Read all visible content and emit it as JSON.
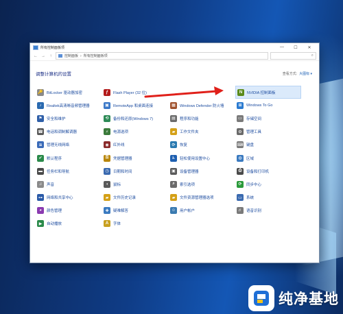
{
  "window": {
    "title": "所有控制面板项",
    "controls": {
      "minimize": "—",
      "maximize": "☐",
      "close": "✕"
    }
  },
  "address": {
    "back": "←",
    "forward": "→",
    "up": "↑",
    "breadcrumbs": [
      "控制面板",
      "所有控制面板项"
    ],
    "search_icon": "⌕"
  },
  "header": {
    "title": "调整计算机的设置",
    "view_by_label": "查看方式:",
    "view_by_value": "大图标 ▾"
  },
  "items": [
    {
      "label": "BitLocker 驱动器加密",
      "icon": "bitlocker-icon",
      "color": "#8a8a8a",
      "glyph": "🔑"
    },
    {
      "label": "Flash Player (32 位)",
      "icon": "flash-icon",
      "color": "#b31b1b",
      "glyph": "ƒ"
    },
    {
      "label": "",
      "icon": "blank-icon",
      "color": "#ffffff",
      "glyph": ""
    },
    {
      "label": "NVIDIA 控制面板",
      "icon": "nvidia-icon",
      "color": "#5a8a1a",
      "glyph": "N"
    },
    {
      "label": "Realtek高清晰音频管理器",
      "icon": "realtek-audio-icon",
      "color": "#2a6ab0",
      "glyph": "♪"
    },
    {
      "label": "RemoteApp 和桌面连接",
      "icon": "remoteapp-icon",
      "color": "#3a78c8",
      "glyph": "▣"
    },
    {
      "label": "Windows Defender 防火墙",
      "icon": "firewall-icon",
      "color": "#a0522d",
      "glyph": "▦"
    },
    {
      "label": "Windows To Go",
      "icon": "windows-to-go-icon",
      "color": "#2a7ad0",
      "glyph": "⊞"
    },
    {
      "label": "安全和维护",
      "icon": "flag-icon",
      "color": "#2f5fa8",
      "glyph": "⚑"
    },
    {
      "label": "备份和还原(Windows 7)",
      "icon": "backup-icon",
      "color": "#2e8b57",
      "glyph": "⟲"
    },
    {
      "label": "程序和功能",
      "icon": "programs-icon",
      "color": "#6b6b6b",
      "glyph": "▤"
    },
    {
      "label": "存储空间",
      "icon": "storage-icon",
      "color": "#7a7a7a",
      "glyph": "▭"
    },
    {
      "label": "电话和调制解调器",
      "icon": "phone-icon",
      "color": "#5a5a5a",
      "glyph": "☎"
    },
    {
      "label": "电源选项",
      "icon": "power-icon",
      "color": "#3a7a3a",
      "glyph": "⚡"
    },
    {
      "label": "工作文件夹",
      "icon": "work-folders-icon",
      "color": "#d4a017",
      "glyph": "▰"
    },
    {
      "label": "管理工具",
      "icon": "admin-tools-icon",
      "color": "#6a6a6a",
      "glyph": "⚙"
    },
    {
      "label": "管理无线网络",
      "icon": "wireless-icon",
      "color": "#3a6ab8",
      "glyph": "≋"
    },
    {
      "label": "红外线",
      "icon": "infrared-icon",
      "color": "#8a2a2a",
      "glyph": "◉"
    },
    {
      "label": "恢复",
      "icon": "recovery-icon",
      "color": "#2a7ab0",
      "glyph": "⟳"
    },
    {
      "label": "键盘",
      "icon": "keyboard-icon",
      "color": "#7a7a7a",
      "glyph": "⌨"
    },
    {
      "label": "默认程序",
      "icon": "default-programs-icon",
      "color": "#2a8a4a",
      "glyph": "✔"
    },
    {
      "label": "凭据管理器",
      "icon": "credential-icon",
      "color": "#b8860b",
      "glyph": "⚿"
    },
    {
      "label": "轻松使用设置中心",
      "icon": "ease-of-access-icon",
      "color": "#1e5fb0",
      "glyph": "♿"
    },
    {
      "label": "区域",
      "icon": "region-icon",
      "color": "#3a7ac0",
      "glyph": "◍"
    },
    {
      "label": "任务栏和导航",
      "icon": "taskbar-icon",
      "color": "#4a4a4a",
      "glyph": "▬"
    },
    {
      "label": "日期和时间",
      "icon": "clock-icon",
      "color": "#3a6ab0",
      "glyph": "◷"
    },
    {
      "label": "设备管理器",
      "icon": "device-manager-icon",
      "color": "#5a5a5a",
      "glyph": "▣"
    },
    {
      "label": "设备和打印机",
      "icon": "printer-icon",
      "color": "#4a4a4a",
      "glyph": "⎙"
    },
    {
      "label": "声音",
      "icon": "sound-icon",
      "color": "#8a8a8a",
      "glyph": "♫"
    },
    {
      "label": "鼠标",
      "icon": "mouse-icon",
      "color": "#5a5a5a",
      "glyph": "◖"
    },
    {
      "label": "索引选项",
      "icon": "indexing-icon",
      "color": "#6a6a6a",
      "glyph": "⌕"
    },
    {
      "label": "同步中心",
      "icon": "sync-icon",
      "color": "#2a9a3a",
      "glyph": "⟳"
    },
    {
      "label": "网络和共享中心",
      "icon": "network-icon",
      "color": "#2a5aa8",
      "glyph": "⊶"
    },
    {
      "label": "文件历史记录",
      "icon": "file-history-icon",
      "color": "#d4a017",
      "glyph": "▰"
    },
    {
      "label": "文件资源管理器选项",
      "icon": "explorer-options-icon",
      "color": "#d4a017",
      "glyph": "▰"
    },
    {
      "label": "系统",
      "icon": "system-icon",
      "color": "#3a6ab0",
      "glyph": "▭"
    },
    {
      "label": "颜色管理",
      "icon": "color-management-icon",
      "color": "#8a3ab0",
      "glyph": "◕"
    },
    {
      "label": "疑难解答",
      "icon": "troubleshooting-icon",
      "color": "#3a7ac0",
      "glyph": "✚"
    },
    {
      "label": "用户帐户",
      "icon": "user-accounts-icon",
      "color": "#3a7ab0",
      "glyph": "☺"
    },
    {
      "label": "语音识别",
      "icon": "speech-icon",
      "color": "#7a7a7a",
      "glyph": "♬"
    },
    {
      "label": "自动播放",
      "icon": "autoplay-icon",
      "color": "#2a8a4a",
      "glyph": "▶"
    },
    {
      "label": "字体",
      "icon": "fonts-icon",
      "color": "#c8a020",
      "glyph": "A"
    }
  ],
  "annotation": {
    "arrow_color": "#e0201a"
  },
  "watermark": {
    "text": "纯净基地"
  }
}
